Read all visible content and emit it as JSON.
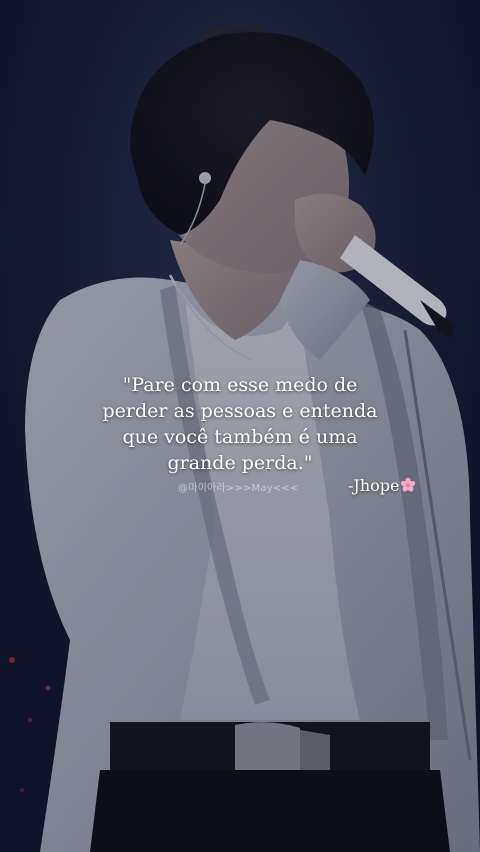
{
  "quote": {
    "lines": [
      "\"Pare com esse medo de",
      "perder as pessoas e entenda",
      "que você também é uma",
      "grande perda.\""
    ]
  },
  "watermark": "@마이아라>>>May<<<",
  "author": "-Jhope",
  "icons": {
    "author_decoration": "cherry-blossom-icon"
  },
  "colors": {
    "background": "#1b2238",
    "text": "#ffffff",
    "blossom": "#f4a9c4"
  }
}
